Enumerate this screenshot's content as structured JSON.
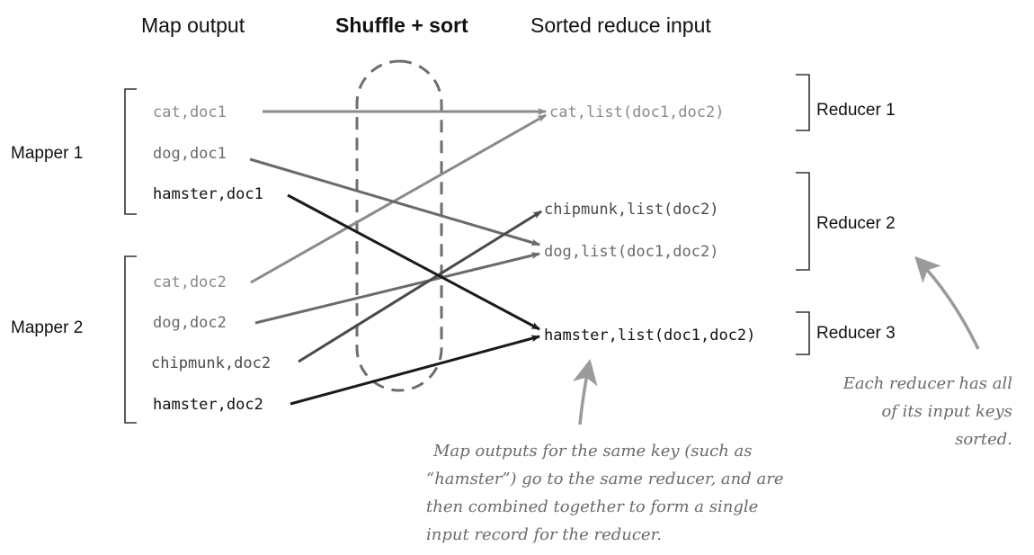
{
  "headers": {
    "map_output": "Map output",
    "shuffle_sort": "Shuffle + sort",
    "sorted_reduce_input": "Sorted reduce input"
  },
  "mappers": [
    {
      "label": "Mapper 1",
      "records": [
        {
          "text": "cat,doc1",
          "key": "cat",
          "color": "#8a8a8a"
        },
        {
          "text": "dog,doc1",
          "key": "dog",
          "color": "#6a6a6a"
        },
        {
          "text": "hamster,doc1",
          "key": "hamster",
          "color": "#111111"
        }
      ]
    },
    {
      "label": "Mapper 2",
      "records": [
        {
          "text": "cat,doc2",
          "key": "cat",
          "color": "#8a8a8a"
        },
        {
          "text": "dog,doc2",
          "key": "dog",
          "color": "#6a6a6a"
        },
        {
          "text": "chipmunk,doc2",
          "key": "chipmunk",
          "color": "#4a4a4a"
        },
        {
          "text": "hamster,doc2",
          "key": "hamster",
          "color": "#111111"
        }
      ]
    }
  ],
  "reduce_inputs": [
    {
      "text": "cat,list(doc1,doc2)",
      "key": "cat",
      "color": "#8a8a8a"
    },
    {
      "text": "chipmunk,list(doc2)",
      "key": "chipmunk",
      "color": "#4a4a4a"
    },
    {
      "text": "dog,list(doc1,doc2)",
      "key": "dog",
      "color": "#6a6a6a"
    },
    {
      "text": "hamster,list(doc1,doc2)",
      "key": "hamster",
      "color": "#111111"
    }
  ],
  "reducers": [
    {
      "label": "Reducer 1"
    },
    {
      "label": "Reducer 2"
    },
    {
      "label": "Reducer 3"
    }
  ],
  "annotations": {
    "center_note": [
      "Map outputs for the same key (such as",
      "“hamster”) go to the same reducer, and are",
      "then combined together to form a single",
      "input record for the reducer."
    ],
    "right_note": [
      "Each reducer has all",
      "of its input keys",
      "sorted."
    ]
  }
}
